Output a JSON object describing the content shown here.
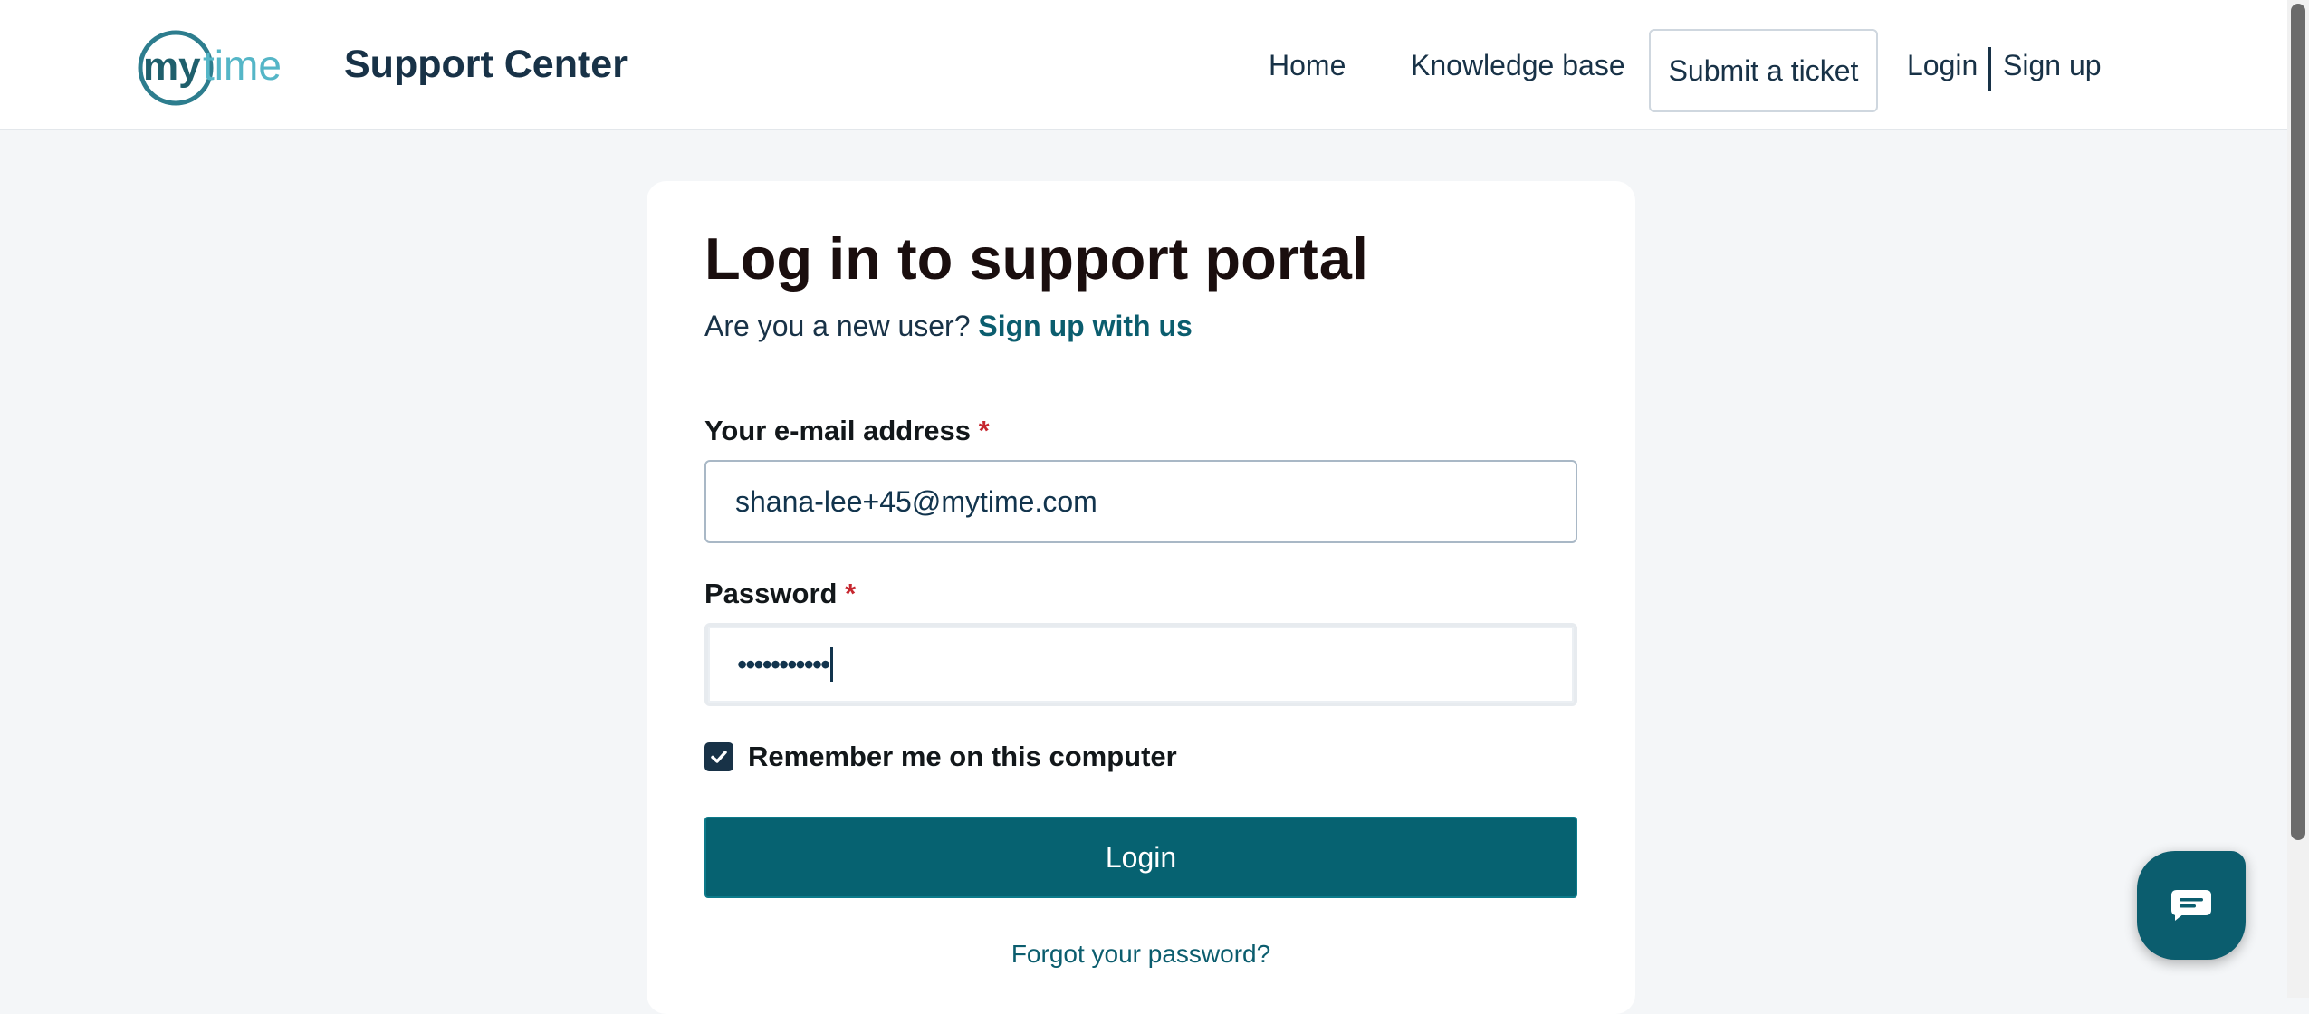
{
  "header": {
    "brand_title": "Support Center",
    "nav": {
      "home": "Home",
      "knowledge_base": "Knowledge base",
      "submit_ticket": "Submit a ticket",
      "login": "Login",
      "signup": "Sign up"
    }
  },
  "login_card": {
    "title": "Log in to support portal",
    "new_user_prompt": "Are you a new user?",
    "signup_link": "Sign up with us",
    "email_label": "Your e-mail address",
    "email_value": "shana-lee+45@mytime.com",
    "password_label": "Password",
    "password_masked": "•••••••••••",
    "required_marker": "*",
    "remember_me_label": "Remember me on this computer",
    "remember_me_checked": true,
    "login_button": "Login",
    "forgot_password": "Forgot your password?"
  },
  "colors": {
    "primary": "#066271",
    "link": "#0b5d6e",
    "heading": "#1a0e0e",
    "nav_text": "#183247",
    "required": "#c6262e",
    "page_bg": "#f4f6f8"
  },
  "icons": {
    "logo": "mytime-logo",
    "checkbox": "check-icon",
    "chat": "chat-bubble-icon"
  }
}
